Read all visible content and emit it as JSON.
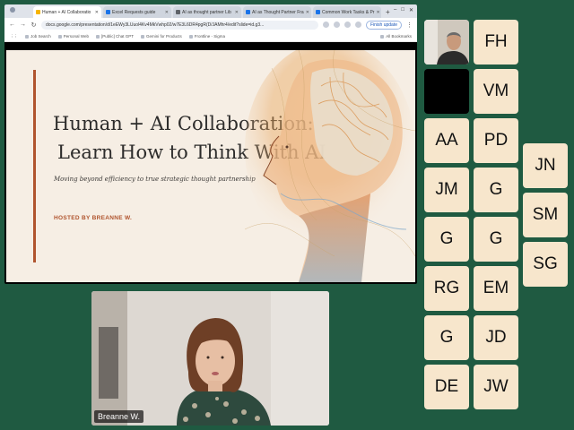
{
  "browser": {
    "tabs": [
      {
        "label": "Human + AI Collaboratio",
        "color": "#f6b400",
        "active": true
      },
      {
        "label": "Excel Requests guide",
        "color": "#1a73e8"
      },
      {
        "label": "AI as thought partner Lib",
        "color": "#5f6368"
      },
      {
        "label": "AI as Thought Partner Fra",
        "color": "#1a73e8"
      },
      {
        "label": "Common Work Tasks & Pr",
        "color": "#1a73e8"
      }
    ],
    "url": "docs.google.com/presentation/d/1eEWy3LUuol4Kv4MkVwhp02/w7E3L6DR4pgR(D/JAMhr4/edit?slide=id.g3...",
    "finish_update": "Finish update",
    "bookmarks": [
      "Job Search",
      "Personal Web",
      "[Public] Chat GPT",
      "Gemini for Products",
      "Frontline - Sigma"
    ],
    "all_bookmarks": "All Bookmarks"
  },
  "slide": {
    "title_line1": "Human + AI Collaboration:",
    "title_line2": "Learn How to Think With AI",
    "subtitle": "Moving beyond efficiency to true strategic thought partnership",
    "host": "HOSTED BY BREANNE W.",
    "accent_color": "#b0542e"
  },
  "presenter": {
    "name": "Breanne W."
  },
  "participants": [
    "FH",
    "VM",
    "AA",
    "PD",
    "JM",
    "G",
    "G",
    "G",
    "RG",
    "EM",
    "G",
    "JD",
    "DE",
    "JW",
    "JN",
    "SM",
    "SG"
  ]
}
